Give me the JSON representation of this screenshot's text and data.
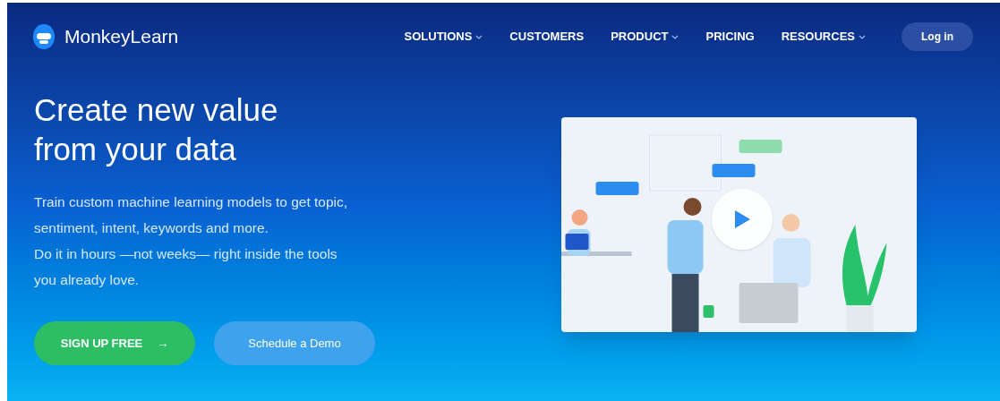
{
  "brand": {
    "name": "MonkeyLearn"
  },
  "nav": [
    {
      "label": "SOLUTIONS",
      "has_dropdown": true
    },
    {
      "label": "CUSTOMERS",
      "has_dropdown": false
    },
    {
      "label": "PRODUCT",
      "has_dropdown": true
    },
    {
      "label": "PRICING",
      "has_dropdown": false
    },
    {
      "label": "RESOURCES",
      "has_dropdown": true
    }
  ],
  "login": "Log in",
  "hero": {
    "title_lines": [
      "Create new value",
      "from your data"
    ],
    "paragraph_lines": [
      "Train custom machine learning models to get topic,",
      "sentiment, intent, keywords and more.",
      "Do it in hours —not weeks— right inside the tools",
      "you already love."
    ],
    "buttons": [
      {
        "label": "SIGN UP FREE",
        "kind": "primary",
        "arrow": "→"
      },
      {
        "label": "Schedule a Demo",
        "kind": "secondary"
      }
    ]
  }
}
